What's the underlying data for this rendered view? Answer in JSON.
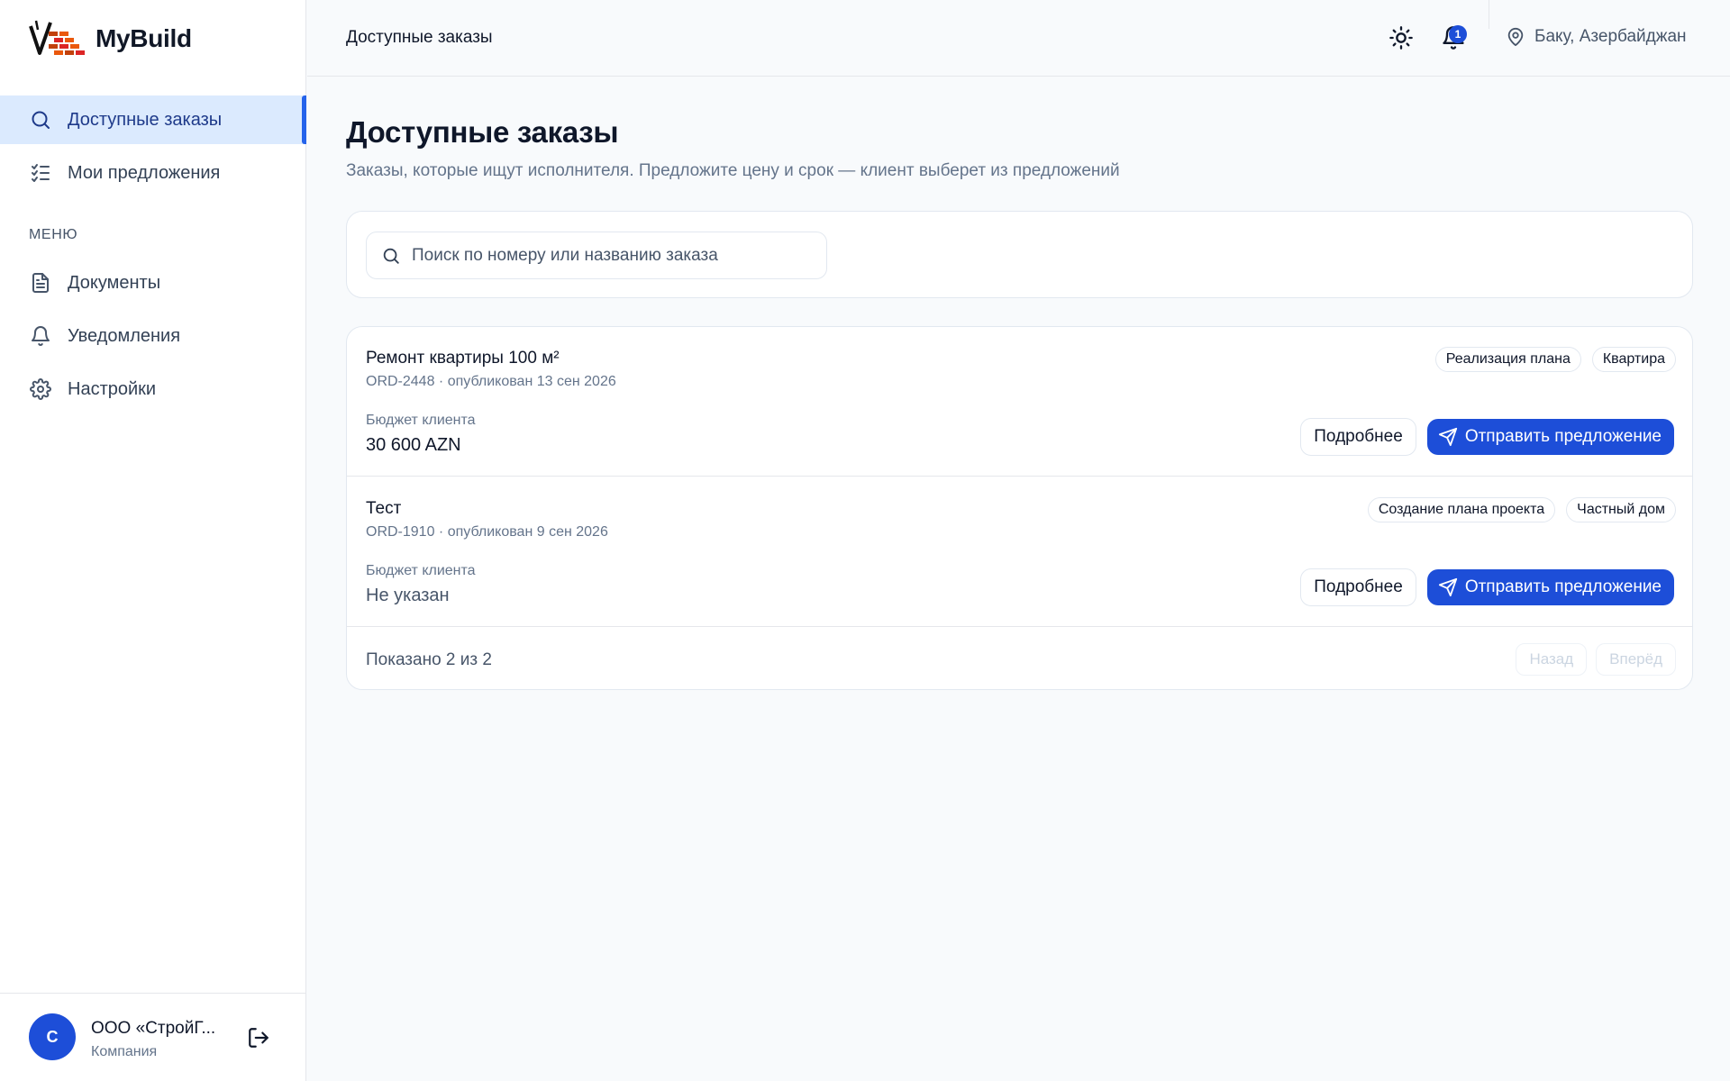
{
  "app": {
    "name": "MyBuild"
  },
  "sidebar": {
    "nav": [
      {
        "label": "Доступные заказы",
        "icon": "search-icon",
        "active": true
      },
      {
        "label": "Мои предложения",
        "icon": "checklist-icon",
        "active": false
      }
    ],
    "menu_label": "МЕНЮ",
    "menu": [
      {
        "label": "Документы",
        "icon": "document-icon"
      },
      {
        "label": "Уведомления",
        "icon": "bell-icon"
      },
      {
        "label": "Настройки",
        "icon": "gear-icon"
      }
    ],
    "user": {
      "initial": "С",
      "name": "ООО «СтройГ...",
      "role": "Компания"
    }
  },
  "topbar": {
    "title": "Доступные заказы",
    "notifications_count": "1",
    "location": "Баку, Азербайджан"
  },
  "main": {
    "title": "Доступные заказы",
    "subtitle": "Заказы, которые ищут исполнителя. Предложите цену и срок — клиент выберет из предложений",
    "search": {
      "placeholder": "Поиск по номеру или названию заказа",
      "value": ""
    },
    "orders": [
      {
        "title": "Ремонт квартиры 100 м²",
        "meta": "ORD-2448 · опубликован 13 сен 2026",
        "budget_label": "Бюджет клиента",
        "budget": "30 600 AZN",
        "tags": [
          "Реализация плана",
          "Квартира"
        ],
        "details_label": "Подробнее",
        "send_label": "Отправить предложение"
      },
      {
        "title": "Тест",
        "meta": "ORD-1910 · опубликован 9 сен 2026",
        "budget_label": "Бюджет клиента",
        "budget": "Не указан",
        "tags": [
          "Создание плана проекта",
          "Частный дом"
        ],
        "details_label": "Подробнее",
        "send_label": "Отправить предложение"
      }
    ],
    "footer": {
      "shown": "Показано 2 из 2",
      "prev": "Назад",
      "next": "Вперёд"
    }
  },
  "colors": {
    "accent": "#1d4ed8",
    "active_bg": "#dbeafe",
    "background": "#f8fafc"
  }
}
